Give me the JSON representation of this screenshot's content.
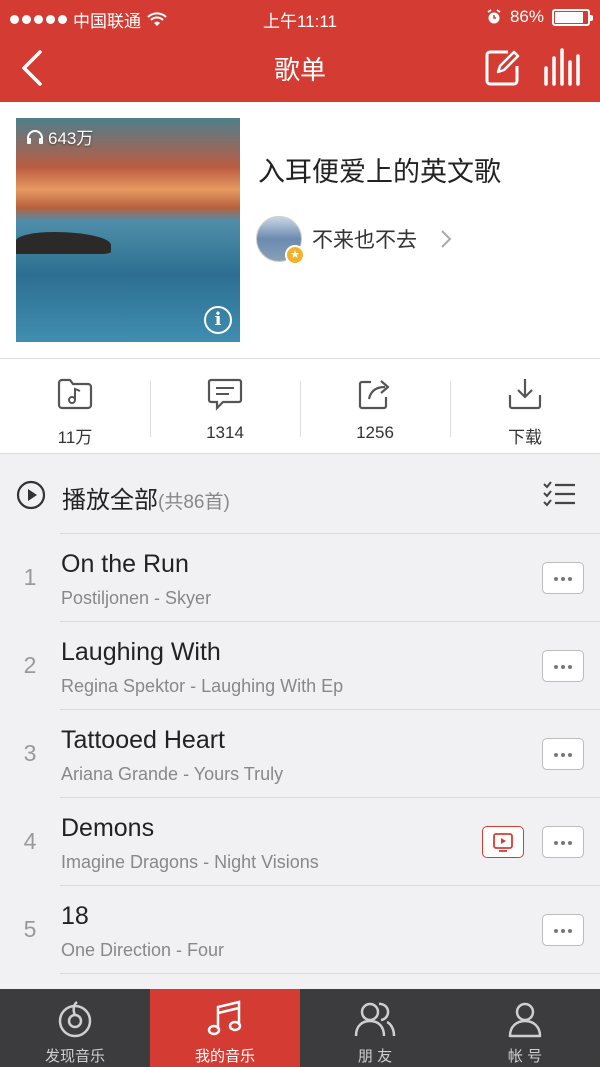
{
  "status_bar": {
    "carrier": "中国联通",
    "time": "上午11:11",
    "battery": "86%",
    "battery_level": 0.86
  },
  "header": {
    "title": "歌单",
    "back_icon": "chevron-left-icon",
    "edit_icon": "edit-icon",
    "equalizer_icon": "equalizer-icon"
  },
  "playlist": {
    "play_count": "643万",
    "title": "入耳便爱上的英文歌",
    "creator": "不来也不去"
  },
  "actions": [
    {
      "label": "11万",
      "icon": "folder-music-icon"
    },
    {
      "label": "1314",
      "icon": "comment-icon"
    },
    {
      "label": "1256",
      "icon": "share-icon"
    },
    {
      "label": "下载",
      "icon": "download-icon"
    }
  ],
  "play_all": {
    "label": "播放全部",
    "count": "(共86首)"
  },
  "songs": [
    {
      "num": "1",
      "title": "On the Run",
      "sub": "Postiljonen - Skyer",
      "mv": false
    },
    {
      "num": "2",
      "title": "Laughing With",
      "sub": "Regina Spektor - Laughing With Ep",
      "mv": false
    },
    {
      "num": "3",
      "title": "Tattooed Heart",
      "sub": "Ariana Grande - Yours Truly",
      "mv": false
    },
    {
      "num": "4",
      "title": "Demons",
      "sub": "Imagine Dragons - Night Visions",
      "mv": true
    },
    {
      "num": "5",
      "title": "18",
      "sub": "One Direction - Four",
      "mv": false
    }
  ],
  "tabs": [
    {
      "label": "发现音乐",
      "icon": "discover-music-icon",
      "active": false
    },
    {
      "label": "我的音乐",
      "icon": "music-note-icon",
      "active": true
    },
    {
      "label": "朋 友",
      "icon": "friends-icon",
      "active": false
    },
    {
      "label": "帐 号",
      "icon": "account-icon",
      "active": false
    }
  ],
  "colors": {
    "brand": "#d43c33",
    "tabbar": "#3c3c3e"
  }
}
